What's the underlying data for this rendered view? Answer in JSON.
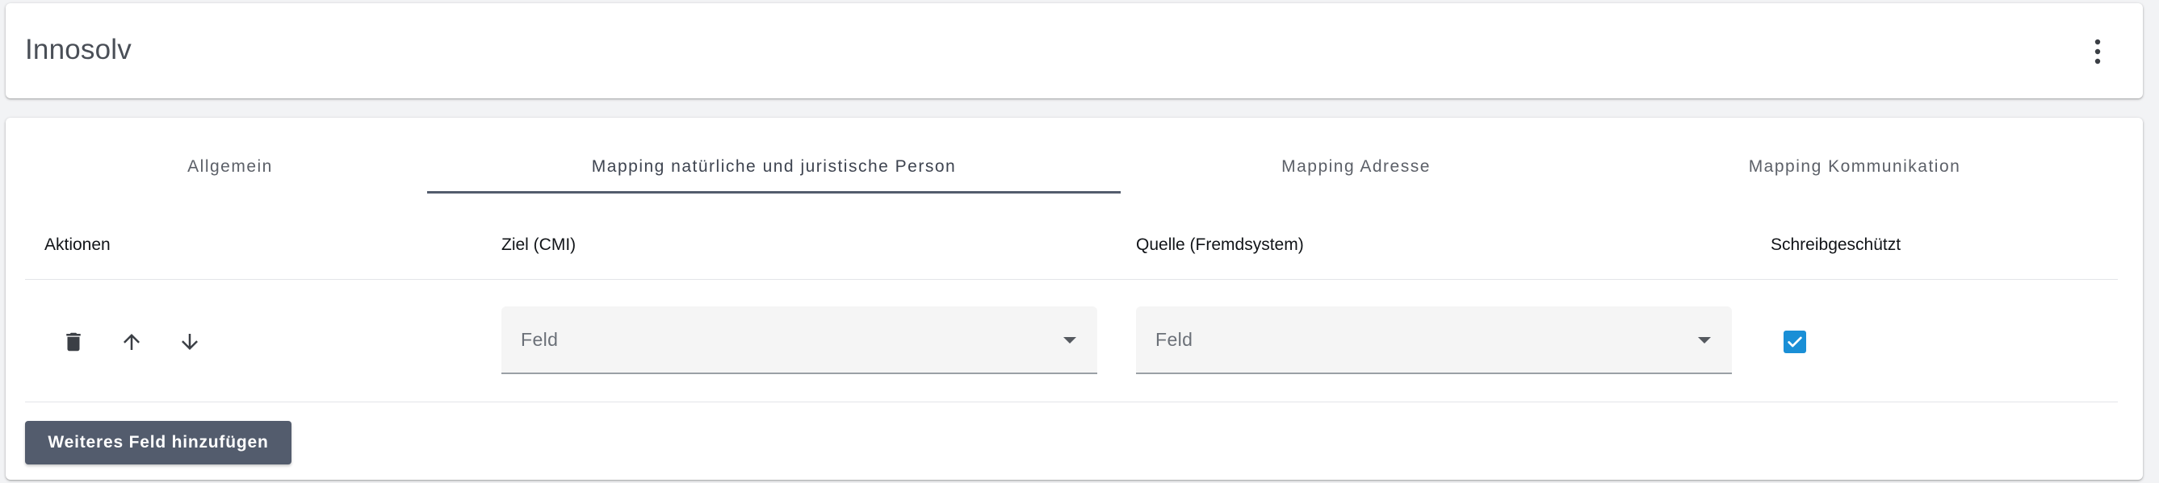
{
  "header": {
    "title": "Innosolv",
    "menu_icon": "more-vertical-icon"
  },
  "tabs": [
    {
      "label": "Allgemein",
      "active": false
    },
    {
      "label": "Mapping natürliche und juristische Person",
      "active": true
    },
    {
      "label": "Mapping Adresse",
      "active": false
    },
    {
      "label": "Mapping Kommunikation",
      "active": false
    }
  ],
  "table": {
    "columns": [
      "Aktionen",
      "Ziel (CMI)",
      "Quelle (Fremdsystem)",
      "Schreibgeschützt"
    ],
    "rows": [
      {
        "actions": [
          "delete-icon",
          "arrow-up-icon",
          "arrow-down-icon"
        ],
        "target_placeholder": "Feld",
        "source_placeholder": "Feld",
        "readonly_checked": true
      }
    ]
  },
  "add_button_label": "Weiteres Feld hinzufügen",
  "colors": {
    "primary": "#535c6d",
    "checkbox": "#1a8fd6",
    "field_bg": "#f5f5f5"
  }
}
